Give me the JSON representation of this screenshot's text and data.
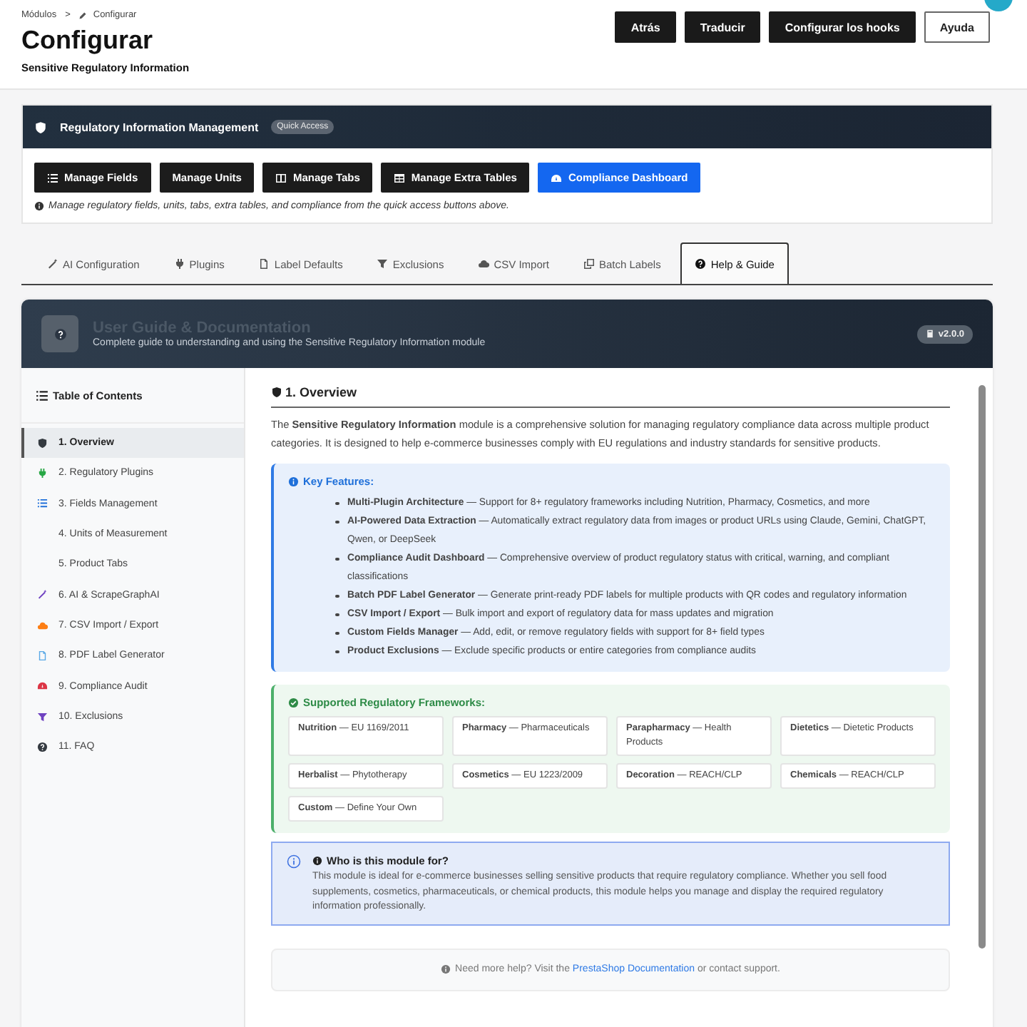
{
  "breadcrumb": {
    "items": [
      "Módulos",
      "Configurar"
    ],
    "separator": ">"
  },
  "page": {
    "title": "Configurar",
    "subtitle": "Sensitive Regulatory Information"
  },
  "header_buttons": [
    {
      "label": "Atrás",
      "kind": "dark"
    },
    {
      "label": "Traducir",
      "kind": "dark"
    },
    {
      "label": "Configurar los hooks",
      "kind": "dark"
    },
    {
      "label": "Ayuda",
      "kind": "outline"
    }
  ],
  "management_panel": {
    "title": "Regulatory Information Management",
    "badge": "Quick Access",
    "buttons": [
      {
        "label": "Manage Fields",
        "kind": "fields"
      },
      {
        "label": "Manage Units",
        "kind": "units"
      },
      {
        "label": "Manage Tabs",
        "kind": "tabs"
      },
      {
        "label": "Manage Extra Tables",
        "kind": "tables"
      },
      {
        "label": "Compliance Dashboard",
        "kind": "dashboard"
      }
    ],
    "note": "Manage regulatory fields, units, tabs, extra tables, and compliance from the quick access buttons above."
  },
  "tabs": [
    {
      "label": "AI Configuration",
      "kind": "wand",
      "selected": false
    },
    {
      "label": "Plugins",
      "kind": "plug",
      "selected": false
    },
    {
      "label": "Label Defaults",
      "kind": "file",
      "selected": false
    },
    {
      "label": "Exclusions",
      "kind": "filter",
      "selected": false
    },
    {
      "label": "CSV Import",
      "kind": "cloud",
      "selected": false
    },
    {
      "label": "Batch Labels",
      "kind": "copy",
      "selected": false
    },
    {
      "label": "Help & Guide",
      "kind": "help",
      "selected": true
    }
  ],
  "guide": {
    "title": "User Guide & Documentation",
    "subtitle": "Complete guide to understanding and using the Sensitive Regulatory Information module",
    "version": "v2.0.0",
    "toc_title": "Table of Contents",
    "toc": [
      {
        "label": "1. Overview",
        "kind": "shield",
        "color": "#343a40",
        "selected": true
      },
      {
        "label": "2. Regulatory Plugins",
        "kind": "plug",
        "color": "#28a745",
        "selected": false
      },
      {
        "label": "3. Fields Management",
        "kind": "list",
        "color": "#1e6fd9",
        "selected": false
      },
      {
        "label": "4. Units of Measurement",
        "selected": false
      },
      {
        "label": "5. Product Tabs",
        "selected": false
      },
      {
        "label": "6. AI & ScrapeGraphAI",
        "kind": "wand",
        "color": "#6f42c1",
        "selected": false
      },
      {
        "label": "7. CSV Import / Export",
        "kind": "cloud",
        "color": "#fd7e14",
        "selected": false
      },
      {
        "label": "8. PDF Label Generator",
        "kind": "file",
        "color": "#5aa9e6",
        "selected": false
      },
      {
        "label": "9. Compliance Audit",
        "kind": "gauge",
        "color": "#dc3545",
        "selected": false
      },
      {
        "label": "10. Exclusions",
        "kind": "filter",
        "color": "#6f42c1",
        "selected": false
      },
      {
        "label": "11. FAQ",
        "kind": "help",
        "color": "#343a40",
        "selected": false
      }
    ],
    "section_title": "1. Overview",
    "intro": "The **Sensitive Regulatory Information** module is a comprehensive solution for managing regulatory compliance data across multiple product categories. It is designed to help e-commerce businesses comply with EU regulations and industry standards for sensitive products.",
    "features_title": "Key Features:",
    "features": [
      "**Multi-Plugin Architecture** — Support for 8+ regulatory frameworks including Nutrition, Pharmacy, Cosmetics, and more",
      "**AI-Powered Data Extraction** — Automatically extract regulatory data from images or product URLs using Claude, Gemini, ChatGPT, Qwen, or DeepSeek",
      "**Compliance Audit Dashboard** — Comprehensive overview of product regulatory status with critical, warning, and compliant classifications",
      "**Batch PDF Label Generator** — Generate print-ready PDF labels for multiple products with QR codes and regulatory information",
      "**CSV Import / Export** — Bulk import and export of regulatory data for mass updates and migration",
      "**Custom Fields Manager** — Add, edit, or remove regulatory fields with support for 8+ field types",
      "**Product Exclusions** — Exclude specific products or entire categories from compliance audits"
    ],
    "frameworks_title": "Supported Regulatory Frameworks:",
    "frameworks": [
      "**Nutrition** — EU 1169/2011",
      "**Pharmacy** — Pharmaceuticals",
      "**Parapharmacy** — Health Products",
      "**Dietetics** — Dietetic Products",
      "**Herbalist** — Phytotherapy",
      "**Cosmetics** — EU 1223/2009",
      "**Decoration** — REACH/CLP",
      "**Chemicals** — REACH/CLP",
      "**Custom** — Define Your Own"
    ],
    "who_title": "Who is this module for?",
    "who_text": "This module is ideal for e-commerce businesses selling sensitive products that require regulatory compliance. Whether you sell food supplements, cosmetics, pharmaceuticals, or chemical products, this module helps you manage and display the required regulatory information professionally.",
    "help": {
      "before": "Need more help? Visit the",
      "link": "PrestaShop Documentation",
      "after": "or contact support."
    }
  }
}
